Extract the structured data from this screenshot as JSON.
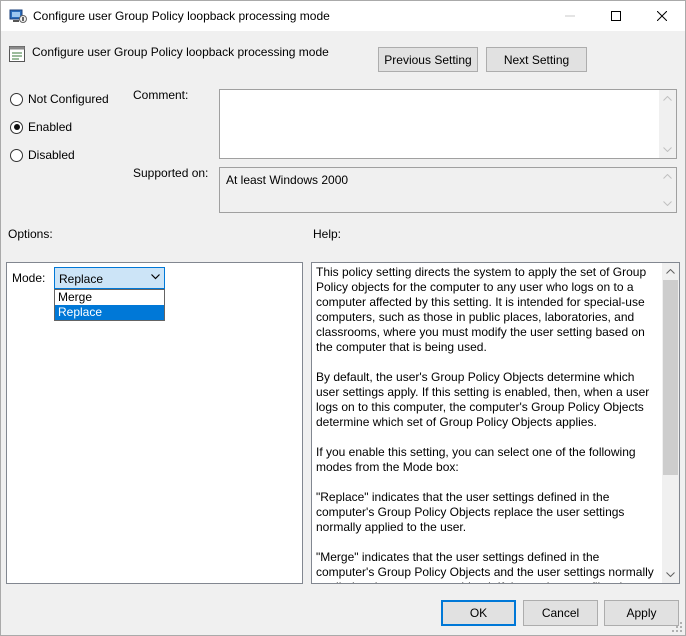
{
  "window": {
    "title": "Configure user Group Policy loopback processing mode"
  },
  "header": {
    "policy_name": "Configure user Group Policy loopback processing mode",
    "prev_button": "Previous Setting",
    "next_button": "Next Setting"
  },
  "state": {
    "options": [
      {
        "label": "Not Configured",
        "checked": false
      },
      {
        "label": "Enabled",
        "checked": true
      },
      {
        "label": "Disabled",
        "checked": false
      }
    ]
  },
  "comment": {
    "label": "Comment:",
    "value": ""
  },
  "supported": {
    "label": "Supported on:",
    "value": "At least Windows 2000"
  },
  "options_section": {
    "label": "Options:",
    "mode_label": "Mode:",
    "mode_value": "Replace",
    "mode_items": [
      {
        "label": "Merge",
        "selected": false
      },
      {
        "label": "Replace",
        "selected": true
      }
    ]
  },
  "help_section": {
    "label": "Help:",
    "paragraphs": [
      "This policy setting directs the system to apply the set of Group Policy objects for the computer to any user who logs on to a computer affected by this setting. It is intended for special-use computers, such as those in public places, laboratories, and classrooms, where you must modify the user setting based on the computer that is being used.",
      "By default, the user's Group Policy Objects determine which user settings apply. If this setting is enabled, then, when a user logs on to this computer, the computer's Group Policy Objects determine which set of Group Policy Objects applies.",
      "If you enable this setting, you can select one of the following modes from the Mode box:",
      "\"Replace\" indicates that the user settings defined in the computer's Group Policy Objects replace the user settings normally applied to the user.",
      "\"Merge\" indicates that the user settings defined in the computer's Group Policy Objects and the user settings normally applied to the user are combined. If the settings conflict, the user settings in the computer's Group Policy Objects take precedence over the user's normal settings."
    ]
  },
  "footer": {
    "ok": "OK",
    "cancel": "Cancel",
    "apply": "Apply"
  },
  "colors": {
    "accent": "#0078d7",
    "combo_fill": "#cce4f7",
    "dialog_bg": "#f0f0f0"
  }
}
